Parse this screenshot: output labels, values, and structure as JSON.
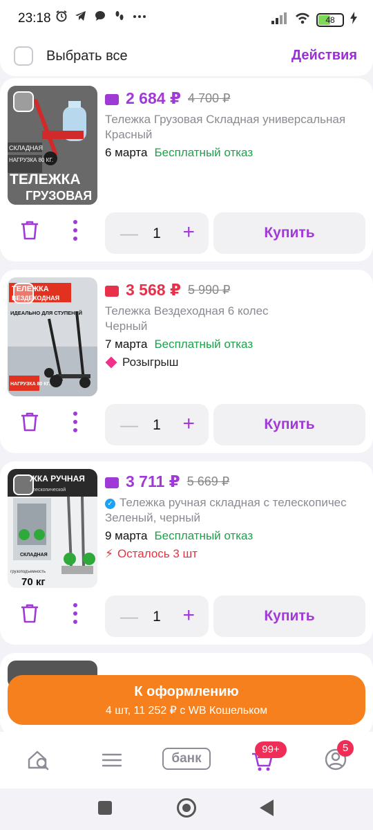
{
  "status_bar": {
    "time": "23:18",
    "battery": "48"
  },
  "select_bar": {
    "label": "Выбрать все",
    "actions": "Действия"
  },
  "products": [
    {
      "price": "2 684 ₽",
      "old_price": "4 700 ₽",
      "price_color": "#a03ad6",
      "name": "Тележка Грузовая Складная универсальная",
      "color": "Красный",
      "date": "6 марта",
      "return_policy": "Бесплатный отказ",
      "quantity": "1",
      "buy_label": "Купить",
      "thumb_text": [
        "СКЛАДНАЯ",
        "НАГРУЗКА 80 КГ.",
        "ТЕЛЕЖКА",
        "ГРУЗОВАЯ"
      ]
    },
    {
      "price": "3 568 ₽",
      "old_price": "5 990 ₽",
      "price_color": "#e8304a",
      "name": "Тележка Вездеходная 6 колес",
      "color": "Черный",
      "date": "7 марта",
      "return_policy": "Бесплатный отказ",
      "extra": "Розыгрыш",
      "quantity": "1",
      "buy_label": "Купить",
      "thumb_text": [
        "ТЕЛЕЖКА",
        "ВЕЗДЕХОДНАЯ",
        "ИДЕАЛЬНО ДЛЯ СТУПЕНЕЙ",
        "НАГРУЗКА 80 КГ."
      ]
    },
    {
      "price": "3 711 ₽",
      "old_price": "5 669 ₽",
      "price_color": "#a03ad6",
      "name": "Тележка ручная складная с телескопичес",
      "color": "Зеленый, черный",
      "date": "9 марта",
      "return_policy": "Бесплатный отказ",
      "extra": "Осталось 3 шт",
      "quantity": "1",
      "buy_label": "Купить",
      "thumb_text": [
        "ЖКА РУЧНАЯ",
        "лескопической",
        "СКЛАДНАЯ",
        "грузоподъемность",
        "70 кг"
      ]
    }
  ],
  "checkout": {
    "title": "К оформлению",
    "subtitle": "4 шт, 11 252 ₽ с WB Кошельком"
  },
  "bottom_nav": {
    "bank_label": "банк",
    "cart_badge": "99+",
    "profile_badge": "5"
  },
  "colors": {
    "accent": "#a03ad6",
    "checkout": "#f7801e",
    "green": "#1ba24a",
    "badge": "#f02d57"
  }
}
